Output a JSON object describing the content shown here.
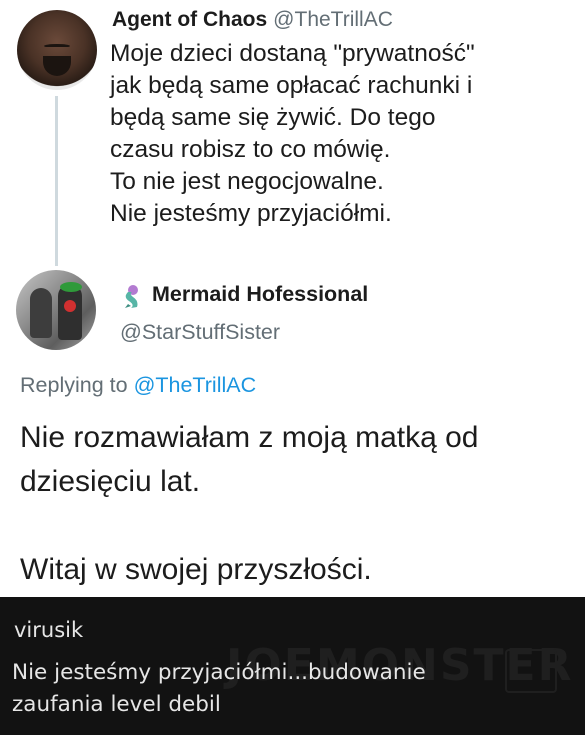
{
  "tweet1": {
    "author_name": "Agent of Chaos",
    "author_handle": "@TheTrillAC",
    "lines": [
      "Moje dzieci dostaną \"prywatność\"",
      "jak będą same opłacać rachunki i",
      "będą same się żywić. Do tego",
      "czasu robisz to co mówię.",
      "To nie jest negocjowalne.",
      "Nie jesteśmy przyjaciółmi."
    ]
  },
  "tweet2": {
    "author_emoji_icon": "mermaid-icon",
    "author_name": "Mermaid Hofessional",
    "author_handle": "@StarStuffSister",
    "replying_prefix": "Replying to",
    "replying_mention": "@TheTrillAC",
    "lines": [
      "Nie rozmawiałam z moją matką od",
      "dziesięciu lat.",
      "Witaj w swojej przyszłości."
    ]
  },
  "comment": {
    "username": "virusik",
    "lines": [
      "Nie jesteśmy przyjaciółmi...budowanie",
      "zaufania level debil"
    ]
  },
  "colors": {
    "text": "#1c1c1c",
    "muted": "#636e75",
    "link": "#1b95e0",
    "comment_bg": "#121212",
    "comment_text": "#e6e6e6"
  }
}
